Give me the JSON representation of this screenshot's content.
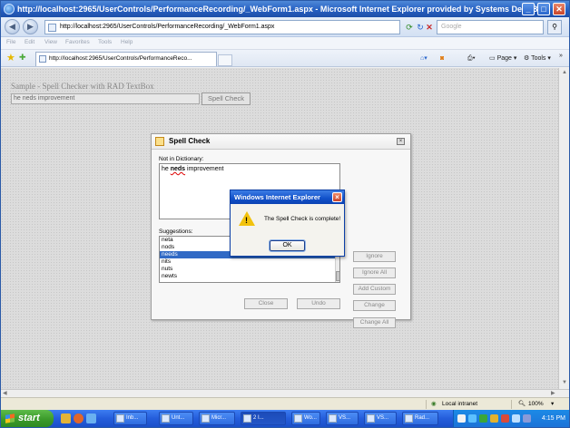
{
  "window": {
    "title": "http://localhost:2965/UserControls/PerformanceRecording/_WebForm1.aspx - Microsoft Internet Explorer provided by Systems Dept.B",
    "controls": {
      "minimize": "_",
      "maximize": "□",
      "close": "✕"
    }
  },
  "addressbar": {
    "back": "◀",
    "forward": "▶",
    "url": "http://localhost:2965/UserControls/PerformanceRecording/_WebForm1.aspx",
    "search_placeholder": "Google"
  },
  "menu": {
    "items": [
      "File",
      "Edit",
      "View",
      "Favorites",
      "Tools",
      "Help"
    ]
  },
  "tabs": {
    "active_title": "http://localhost:2965/UserControls/PerformanceReco...",
    "page_label": "Page",
    "tools_label": "Tools",
    "more": "»"
  },
  "page": {
    "heading": "Sample - Spell Checker with RAD TextBox",
    "textbox_value": "he neds improvement",
    "spellcheck_button": "Spell Check"
  },
  "spell_dialog": {
    "title": "Spell Check",
    "not_in_dictionary_label": "Not in Dictionary:",
    "text_before": "he ",
    "misspelled": "neds",
    "text_after": " improvement",
    "suggestions_label": "Suggestions:",
    "suggestions": [
      "neta",
      "nods",
      "needs",
      "nits",
      "nuts",
      "newts"
    ],
    "selected_suggestion": "needs",
    "buttons": {
      "ignore": "Ignore",
      "ignore_all": "Ignore All",
      "add_custom": "Add Custom",
      "change": "Change",
      "change_all": "Change All",
      "close": "Close",
      "undo": "Undo"
    }
  },
  "alert": {
    "title": "Windows Internet Explorer",
    "message": "The Spell Check is complete!",
    "ok": "OK"
  },
  "statusbar": {
    "zone": "Local intranet",
    "zoom": "100%"
  },
  "taskbar": {
    "start": "start",
    "items": [
      "Inb...",
      "Unt...",
      "Micr...",
      "2 I...",
      "Wo...",
      "VS...",
      "VS...",
      "Rad..."
    ],
    "clock": "4:15 PM"
  }
}
